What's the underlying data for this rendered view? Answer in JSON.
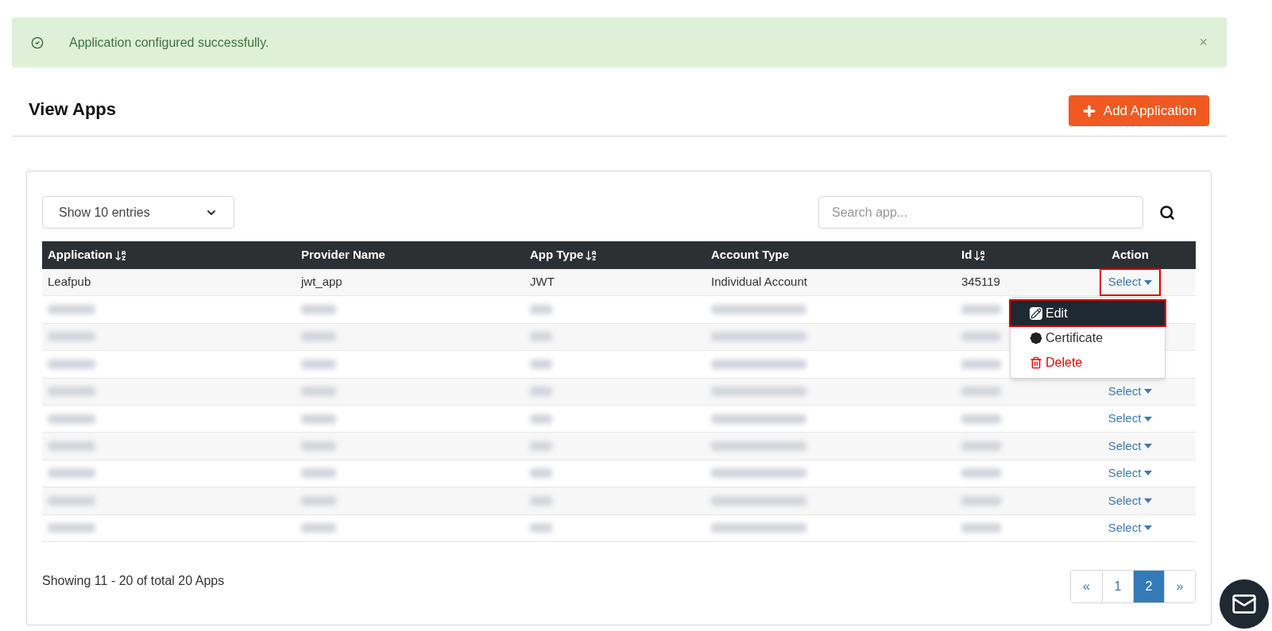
{
  "alert": {
    "message": "Application configured successfully.",
    "close": "×"
  },
  "header": {
    "title": "View Apps",
    "add_button": "Add Application"
  },
  "controls": {
    "entries": "Show 10 entries",
    "search_placeholder": "Search app..."
  },
  "table": {
    "columns": [
      {
        "label": "Application",
        "sortable": true
      },
      {
        "label": "Provider Name",
        "sortable": false
      },
      {
        "label": "App Type",
        "sortable": true
      },
      {
        "label": "Account Type",
        "sortable": false
      },
      {
        "label": "Id",
        "sortable": true
      },
      {
        "label": "Action",
        "sortable": false
      }
    ],
    "rows": [
      {
        "blurred": false,
        "cells": [
          "Leafpub",
          "jwt_app",
          "JWT",
          "Individual Account",
          "345119"
        ],
        "action": "Select",
        "highlighted": true,
        "expanded": true
      },
      {
        "blurred": true
      },
      {
        "blurred": true
      },
      {
        "blurred": true
      },
      {
        "blurred": true,
        "action": "Select",
        "highlighted": false,
        "expanded": false
      },
      {
        "blurred": true,
        "action": "Select",
        "highlighted": false,
        "expanded": false
      },
      {
        "blurred": true,
        "action": "Select",
        "highlighted": false,
        "expanded": false
      },
      {
        "blurred": true,
        "action": "Select",
        "highlighted": false,
        "expanded": false
      },
      {
        "blurred": true,
        "action": "Select",
        "highlighted": false,
        "expanded": false
      },
      {
        "blurred": true,
        "action": "Select",
        "highlighted": false,
        "expanded": false
      }
    ]
  },
  "menu": {
    "items": [
      {
        "kind": "edit",
        "label": "Edit",
        "selected": true,
        "highlighted": true
      },
      {
        "kind": "certificate",
        "label": "Certificate",
        "selected": false,
        "highlighted": false
      },
      {
        "kind": "delete",
        "label": "Delete",
        "selected": false,
        "highlighted": false
      }
    ]
  },
  "footer": {
    "summary": "Showing 11 - 20 of total 20 Apps"
  },
  "pagination": [
    {
      "label": "«",
      "selected": false
    },
    {
      "label": "1",
      "selected": false
    },
    {
      "label": "2",
      "selected": true
    },
    {
      "label": "»",
      "selected": false
    }
  ]
}
